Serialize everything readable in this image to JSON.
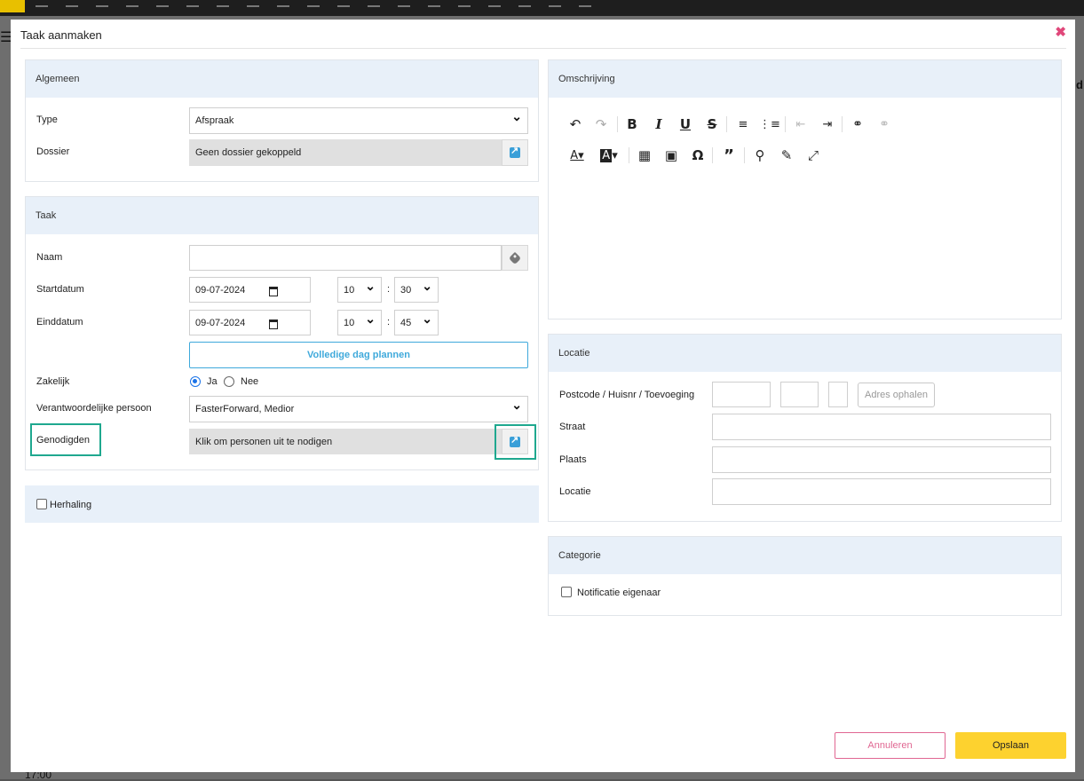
{
  "background": {
    "hour_label": "17:00",
    "edge_letter": "d"
  },
  "modal": {
    "title": "Taak aanmaken",
    "close_icon": "close-icon"
  },
  "algemeen": {
    "heading": "Algemeen",
    "type_label": "Type",
    "type_value": "Afspraak",
    "dossier_label": "Dossier",
    "dossier_value": "Geen dossier gekoppeld"
  },
  "taak": {
    "heading": "Taak",
    "naam_label": "Naam",
    "naam_value": "",
    "startdatum_label": "Startdatum",
    "startdatum_value": "09-07-2024",
    "start_hour": "10",
    "start_minute": "30",
    "einddatum_label": "Einddatum",
    "einddatum_value": "09-07-2024",
    "end_hour": "10",
    "end_minute": "45",
    "time_separator": ":",
    "full_day_button": "Volledige dag plannen",
    "zakelijk_label": "Zakelijk",
    "zakelijk_ja": "Ja",
    "zakelijk_nee": "Nee",
    "zakelijk_selected": "Ja",
    "verantwoordelijke_label": "Verantwoordelijke persoon",
    "verantwoordelijke_value": "FasterForward, Medior",
    "genodigden_label": "Genodigden",
    "genodigden_value": "Klik om personen uit te nodigen"
  },
  "herhaling": {
    "label": "Herhaling",
    "checked": false
  },
  "omschrijving": {
    "heading": "Omschrijving",
    "toolbar_row1": [
      "undo-icon",
      "redo-icon",
      "bold-icon",
      "italic-icon",
      "underline-icon",
      "strikethrough-icon",
      "numbered-list-icon",
      "bullet-list-icon",
      "outdent-icon",
      "indent-icon",
      "link-icon",
      "unlink-icon"
    ],
    "toolbar_row2": [
      "text-color-icon",
      "background-color-icon",
      "table-icon",
      "image-icon",
      "special-char-icon",
      "blockquote-icon",
      "find-replace-icon",
      "source-icon",
      "fullscreen-icon"
    ]
  },
  "locatie": {
    "heading": "Locatie",
    "postcode_label": "Postcode / Huisnr / Toevoeging",
    "adres_button": "Adres ophalen",
    "straat_label": "Straat",
    "plaats_label": "Plaats",
    "locatie_label": "Locatie"
  },
  "categorie": {
    "heading": "Categorie",
    "notificatie_label": "Notificatie eigenaar",
    "notificatie_checked": false
  },
  "footer": {
    "cancel_label": "Annuleren",
    "save_label": "Opslaan"
  },
  "colors": {
    "accent_blue": "#3fa9db",
    "highlight_teal": "#1fa88f",
    "save_yellow": "#fdd22f",
    "cancel_pink": "#e06792",
    "panel_header": "#e8f0f9"
  }
}
